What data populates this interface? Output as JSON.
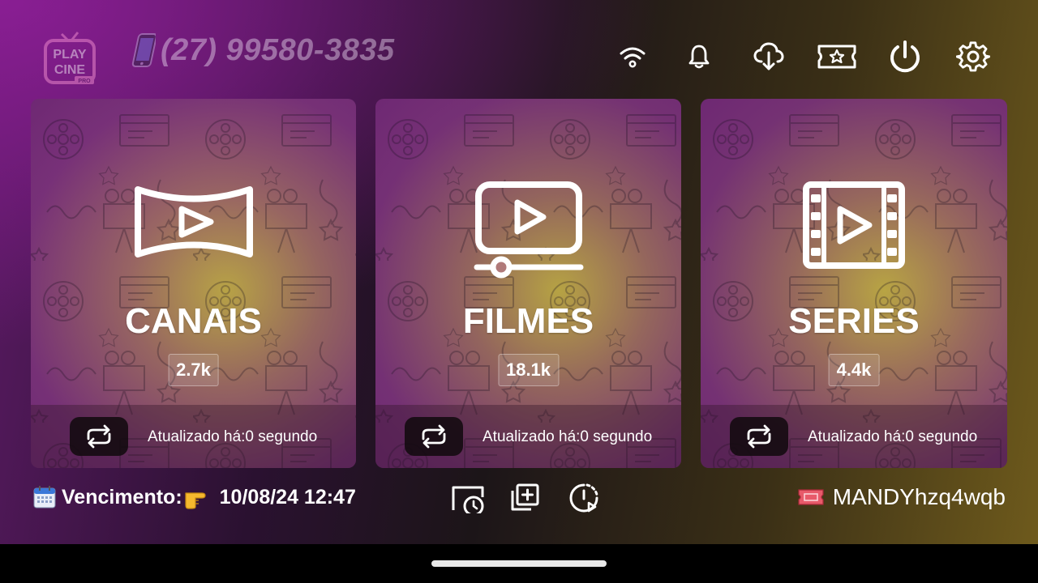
{
  "header": {
    "logo_text_top": "PLAY",
    "logo_text_bottom": "CINE",
    "logo_badge": "PRO",
    "phone": "(27) 99580-3835",
    "phone_icon": "mobile-phone-icon",
    "top_icons": [
      "wifi-icon",
      "bell-icon",
      "cloud-download-icon",
      "ticket-star-icon",
      "power-icon",
      "gear-icon"
    ]
  },
  "cards": [
    {
      "title": "CANAIS",
      "count": "2.7k",
      "updated": "Atualizado há:0 segundo",
      "icon": "live-tv-panorama-icon"
    },
    {
      "title": "FILMES",
      "count": "18.1k",
      "updated": "Atualizado há:0 segundo",
      "icon": "movie-play-monitor-icon"
    },
    {
      "title": "SERIES",
      "count": "4.4k",
      "updated": "Atualizado há:0 segundo",
      "icon": "film-strip-icon"
    }
  ],
  "footer": {
    "expiry_label": "Vencimento:",
    "expiry_date": "10/08/24 12:47",
    "username": "MANDYhzq4wqb",
    "icons": [
      "calendar-emoji-icon",
      "pointing-hand-emoji-icon",
      "history-icon",
      "add-playlist-icon",
      "recent-play-icon",
      "ticket-emoji-icon"
    ]
  },
  "colors": {
    "brand_purple": "#8c1e96",
    "gold": "#be aa46",
    "card_bottom_bar": "#32142880"
  }
}
